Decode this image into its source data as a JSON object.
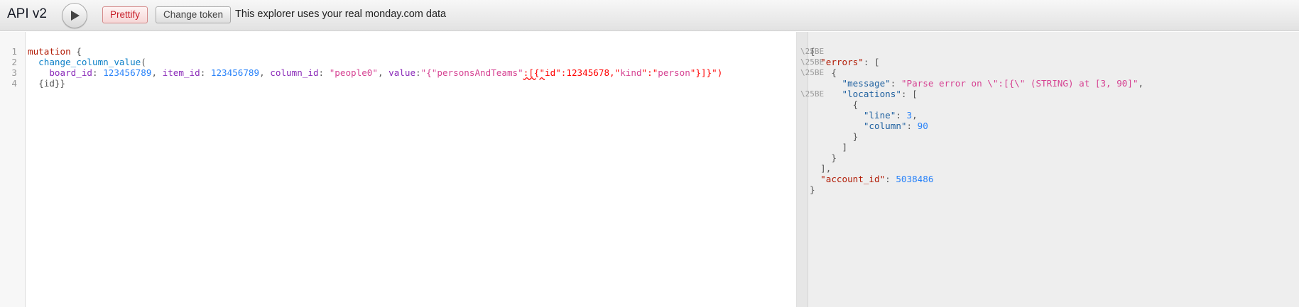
{
  "app": {
    "title": "API v2",
    "prettify_label": "Prettify",
    "change_token_label": "Change token",
    "notice": "This explorer uses your real monday.com data"
  },
  "editor": {
    "line_numbers": [
      "1",
      "2",
      "3",
      "4"
    ],
    "code": {
      "l1_keyword": "mutation",
      "l1_brace": " {",
      "l2_field": "change_column_value",
      "l2_paren": "(",
      "l3_arg1": "board_id",
      "l3_sep1": ": ",
      "l3_val1": "123456789",
      "l3_comma1": ", ",
      "l3_arg2": "item_id",
      "l3_sep2": ": ",
      "l3_val2": "123456789",
      "l3_comma2": ", ",
      "l3_arg3": "column_id",
      "l3_sep3": ": ",
      "l3_val3": "\"people0\"",
      "l3_comma3": ", ",
      "l3_arg4": "value",
      "l3_sep4": ":",
      "l3_val4_str": "\"{\"personsAndTeams\"",
      "l3_val4_err": ":[{\"",
      "l3_val4_rest": "id\":12345678,\"",
      "l3_val4_kind": "kind",
      "l3_val4_colon": "\":\"",
      "l3_val4_person": "person",
      "l3_val4_end": "\"}]}\")",
      "l4_text": "{id}}"
    }
  },
  "result": {
    "fold_marker": "\\25BE",
    "lines": {
      "open": "{",
      "errors_key": "\"errors\"",
      "errors_open": ": [",
      "obj_open": "{",
      "message_key": "\"message\"",
      "message_colon": ": ",
      "message_val": "\"Parse error on \\\":[{\\\" (STRING) at [3, 90]\"",
      "message_comma": ",",
      "locations_key": "\"locations\"",
      "locations_open": ": [",
      "loc_obj_open": "{",
      "line_key": "\"line\"",
      "line_colon": ": ",
      "line_val": "3",
      "line_comma": ",",
      "column_key": "\"column\"",
      "column_colon": ": ",
      "column_val": "90",
      "loc_obj_close": "}",
      "locations_close": "]",
      "obj_close": "}",
      "errors_close": "],",
      "account_key": "\"account_id\"",
      "account_colon": ": ",
      "account_val": "5038486",
      "close": "}"
    }
  }
}
